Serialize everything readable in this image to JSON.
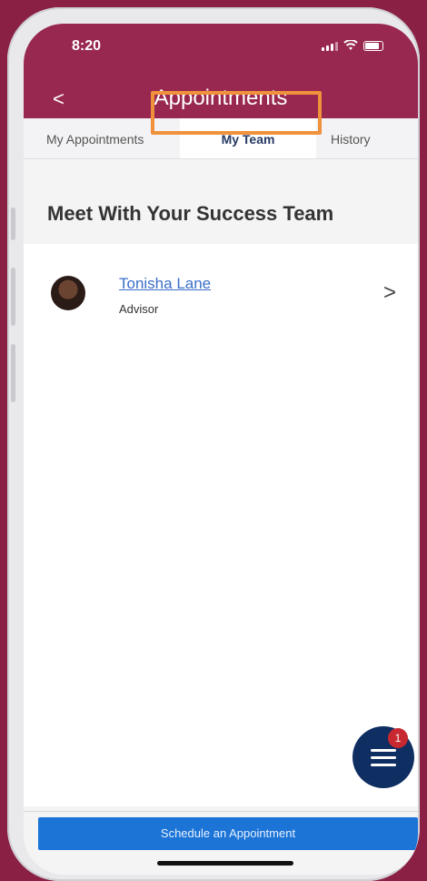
{
  "status_bar": {
    "time": "8:20"
  },
  "header": {
    "title": "Appointments"
  },
  "tabs": [
    {
      "label": "My Appointments",
      "active": false
    },
    {
      "label": "My Team",
      "active": true
    },
    {
      "label": "History",
      "active": false
    }
  ],
  "section": {
    "title": "Meet With Your Success Team"
  },
  "team": [
    {
      "name": "Tonisha Lane",
      "role": "Advisor"
    }
  ],
  "fab": {
    "badge_count": "1"
  },
  "footer": {
    "schedule_label": "Schedule an Appointment"
  },
  "colors": {
    "header": "#98284f",
    "highlight": "#f0913c",
    "primary_button": "#1b74d6",
    "fab": "#0f2e61"
  }
}
